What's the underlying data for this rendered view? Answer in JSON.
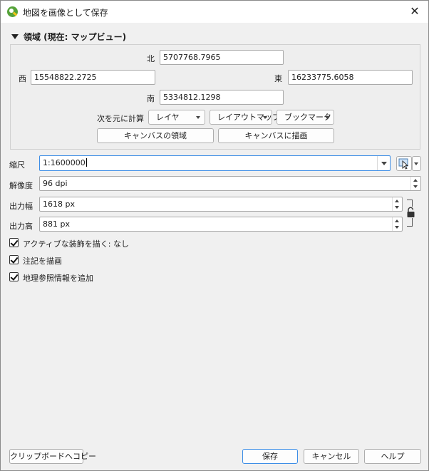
{
  "window": {
    "title": "地図を画像として保存"
  },
  "extent": {
    "header": "領域 (現在: マップビュー)",
    "north_label": "北",
    "north_value": "5707768.7965",
    "west_label": "西",
    "west_value": "15548822.2725",
    "east_label": "東",
    "east_value": "16233775.6058",
    "south_label": "南",
    "south_value": "5334812.1298",
    "calc_from_label": "次を元に計算",
    "layer_dd": "レイヤ",
    "layout_map_dd": "レイアウトマップ",
    "bookmark_dd": "ブックマーク",
    "canvas_extent_btn": "キャンバスの領域",
    "draw_on_canvas_btn": "キャンバスに描画"
  },
  "scale": {
    "label": "縮尺",
    "value": "1:1600000"
  },
  "resolution": {
    "label": "解像度",
    "value": "96 dpi"
  },
  "output_width": {
    "label": "出力幅",
    "value": "1618 px"
  },
  "output_height": {
    "label": "出力高",
    "value": "881 px"
  },
  "checks": [
    {
      "label": "アクティブな装飾を描く: なし",
      "checked": true
    },
    {
      "label": "注記を描画",
      "checked": true
    },
    {
      "label": "地理参照情報を追加",
      "checked": true
    }
  ],
  "footer": {
    "clipboard_btn": "クリップボードへコピー",
    "save_btn": "保存",
    "cancel_btn": "キャンセル",
    "help_btn": "ヘルプ"
  },
  "colors": {
    "focus": "#3d8ee6",
    "qgis_green": "#56a33a",
    "qgis_yellow": "#f0c419"
  }
}
